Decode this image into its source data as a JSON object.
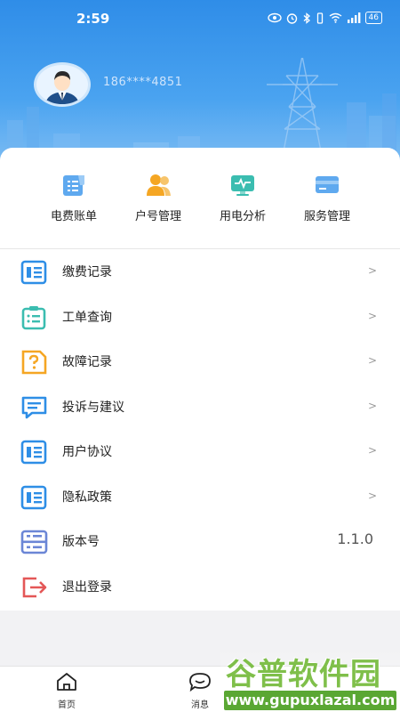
{
  "status_bar": {
    "time": "2:59",
    "battery": "46"
  },
  "profile": {
    "phone": "186****4851"
  },
  "quick_actions": [
    {
      "label": "电费账单",
      "icon": "bill-icon"
    },
    {
      "label": "户号管理",
      "icon": "users-icon"
    },
    {
      "label": "用电分析",
      "icon": "analysis-icon"
    },
    {
      "label": "服务管理",
      "icon": "card-icon"
    }
  ],
  "menu": [
    {
      "label": "缴费记录",
      "icon": "document-icon",
      "chevron": ">"
    },
    {
      "label": "工单查询",
      "icon": "clipboard-icon",
      "chevron": ">"
    },
    {
      "label": "故障记录",
      "icon": "fault-report-icon",
      "chevron": ">"
    },
    {
      "label": "投诉与建议",
      "icon": "message-icon",
      "chevron": ">"
    },
    {
      "label": "用户协议",
      "icon": "document-icon",
      "chevron": ">"
    },
    {
      "label": "隐私政策",
      "icon": "document-icon",
      "chevron": ">"
    },
    {
      "label": "版本号",
      "icon": "server-icon",
      "value": "1.1.0"
    },
    {
      "label": "退出登录",
      "icon": "logout-icon"
    }
  ],
  "tabs": [
    {
      "label": "首页",
      "icon": "home-icon"
    },
    {
      "label": "消息",
      "icon": "chat-icon"
    }
  ],
  "watermark": {
    "title": "谷普软件园",
    "url": "www.gupuxlazal.com"
  },
  "colors": {
    "header_top": "#2f8de8",
    "header_bottom": "#7cbcf3",
    "icon_blue": "#2e8ee6",
    "icon_teal": "#3bbdb0",
    "icon_orange": "#f5a623",
    "icon_slate": "#6b86d6",
    "icon_red": "#e45757",
    "watermark_green": "#5aa733"
  }
}
